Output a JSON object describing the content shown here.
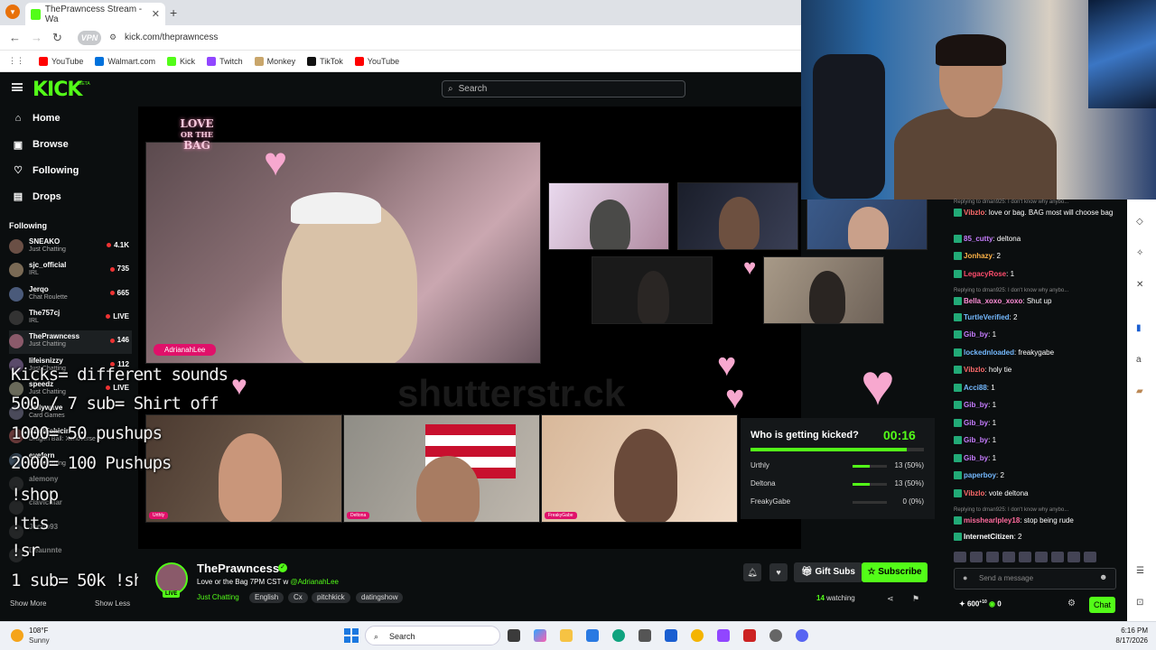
{
  "browser": {
    "tab_title": "ThePrawncess Stream - Wa",
    "new_tab": "+",
    "url": "kick.com/theprawncess",
    "vpn": "VPN",
    "bookmarks": [
      {
        "label": "YouTube",
        "color": "#ff0000"
      },
      {
        "label": "Walmart.com",
        "color": "#0071dc"
      },
      {
        "label": "Kick",
        "color": "#53fc18"
      },
      {
        "label": "Twitch",
        "color": "#9146ff"
      },
      {
        "label": "Monkey",
        "color": "#c9a66b"
      },
      {
        "label": "TikTok",
        "color": "#111111"
      },
      {
        "label": "YouTube",
        "color": "#ff0000"
      }
    ]
  },
  "kick": {
    "logo": "KICK",
    "beta": "BETA",
    "search_placeholder": "Search",
    "nav": [
      {
        "label": "Home",
        "icon": "home-icon",
        "glyph": "⌂"
      },
      {
        "label": "Browse",
        "icon": "browse-icon",
        "glyph": "▣"
      },
      {
        "label": "Following",
        "icon": "heart-icon",
        "glyph": "♡"
      },
      {
        "label": "Drops",
        "icon": "drops-icon",
        "glyph": "▤"
      }
    ],
    "following_header": "Following",
    "following": [
      {
        "name": "SNEAKO",
        "sub": "Just Chatting",
        "viewers": "4.1K",
        "dim": false
      },
      {
        "name": "sjc_official",
        "sub": "IRL",
        "viewers": "735",
        "dim": false
      },
      {
        "name": "Jerqo",
        "sub": "Chat Roulette",
        "viewers": "665",
        "dim": false
      },
      {
        "name": "The757cj",
        "sub": "IRL",
        "viewers": "LIVE",
        "dim": false
      },
      {
        "name": "ThePrawncess",
        "sub": "Just Chatting",
        "viewers": "146",
        "dim": false
      },
      {
        "name": "lifeisnizzy",
        "sub": "Just Chatting",
        "viewers": "112",
        "dim": false
      },
      {
        "name": "speedz",
        "sub": "Just Chatting",
        "viewers": "LIVE",
        "dim": false
      },
      {
        "name": "Jellywave",
        "sub": "Card Games",
        "viewers": "",
        "dim": false
      },
      {
        "name": "CoolFehicin",
        "sub": "Dragon Ball: Xenoverse 2",
        "viewers": "",
        "dim": false
      },
      {
        "name": "eyefern",
        "sub": "Just Chatting",
        "viewers": "",
        "dim": false
      },
      {
        "name": "alemony",
        "sub": "",
        "viewers": "",
        "dim": true
      },
      {
        "name": "clavicular",
        "sub": "",
        "viewers": "",
        "dim": true
      },
      {
        "name": "Jacob93",
        "sub": "",
        "viewers": "",
        "dim": true
      },
      {
        "name": "Deaunnte",
        "sub": "",
        "viewers": "",
        "dim": true
      }
    ],
    "show_more": "Show More",
    "show_less": "Show Less"
  },
  "stream": {
    "logo_lines": [
      "LOVE",
      "OR THE",
      "BAG"
    ],
    "host_label": "AdrianahLee",
    "watermark": "shutterstr.ck",
    "overlay_lines": [
      "Kicks= different sounds",
      "500 / 7 sub= Shirt off",
      "1000= 50 pushups",
      "2000= 100 Pushups",
      "!shop",
      "!tts",
      "!sr",
      "1 sub= 50k !shop points"
    ],
    "cam_labels": [
      "Urthly",
      "Deltona",
      "FreakyGabe"
    ],
    "poll": {
      "question": "Who is getting kicked?",
      "timer": "00:16",
      "timer_fraction": 0.9,
      "options": [
        {
          "name": "Urthly",
          "votes": "13 (50%)",
          "fraction": 0.5
        },
        {
          "name": "Deltona",
          "votes": "13 (50%)",
          "fraction": 0.5
        },
        {
          "name": "FreakyGabe",
          "votes": "0 (0%)",
          "fraction": 0
        }
      ]
    }
  },
  "channel": {
    "name": "ThePrawncess",
    "live": "LIVE",
    "title": "Love or the Bag 7PM CST w",
    "title_mention": "@AdrianahLee",
    "category": "Just Chatting",
    "tags": [
      "English",
      "Cx",
      "pitchkick",
      "datingshow"
    ],
    "gift_subs": "Gift Subs",
    "subscribe": "Subscribe",
    "watching_count": "14",
    "watching_label": "watching"
  },
  "chat": {
    "messages": [
      {
        "reply": "Replying to dman925: I don't know why anybo...",
        "user": "Vibzlo",
        "color": "#ff6b6b",
        "text": "love or bag. BAG most will choose bag"
      },
      {
        "reply": "",
        "user": "85_cutty",
        "color": "#c77dff",
        "text": "deltona"
      },
      {
        "reply": "",
        "user": "Jonhazy",
        "color": "#ffb347",
        "text": "2"
      },
      {
        "reply": "",
        "user": "LegacyRose",
        "color": "#ff4d6d",
        "text": "1"
      },
      {
        "reply": "Replying to dman925: I don't know why anybo...",
        "user": "Bella_xoxo_xoxo",
        "color": "#ff8fd8",
        "text": "Shut up"
      },
      {
        "reply": "",
        "user": "TurtleVerified",
        "color": "#74b9ff",
        "text": "2"
      },
      {
        "reply": "",
        "user": "Gib_by",
        "color": "#c77dff",
        "text": "1"
      },
      {
        "reply": "",
        "user": "lockednloaded",
        "color": "#74b9ff",
        "text": "freakygabe"
      },
      {
        "reply": "",
        "user": "Vibzlo",
        "color": "#ff6b6b",
        "text": "holy tie"
      },
      {
        "reply": "",
        "user": "Acci88",
        "color": "#74b9ff",
        "text": "1"
      },
      {
        "reply": "",
        "user": "Gib_by",
        "color": "#c77dff",
        "text": "1"
      },
      {
        "reply": "",
        "user": "Gib_by",
        "color": "#c77dff",
        "text": "1"
      },
      {
        "reply": "",
        "user": "Gib_by",
        "color": "#c77dff",
        "text": "1"
      },
      {
        "reply": "",
        "user": "Gib_by",
        "color": "#c77dff",
        "text": "1"
      },
      {
        "reply": "",
        "user": "paperboy",
        "color": "#74b9ff",
        "text": "2"
      },
      {
        "reply": "",
        "user": "Vibzlo",
        "color": "#ff6b6b",
        "text": "vote deltona"
      },
      {
        "reply": "Replying to dman925: I don't know why anybo...",
        "user": "misshearlpley18",
        "color": "#ff6b9d",
        "text": "stop being rude"
      },
      {
        "reply": "",
        "user": "InternetCitizen",
        "color": "#ffffff",
        "text": "2"
      }
    ],
    "send_placeholder": "Send a message",
    "points": "600",
    "points_sup": "+10",
    "points_zero": "0",
    "chat_button": "Chat"
  },
  "taskbar": {
    "temp": "108°F",
    "weather": "Sunny",
    "search": "Search",
    "time": "6:16 PM",
    "date": "8/17/2026"
  }
}
